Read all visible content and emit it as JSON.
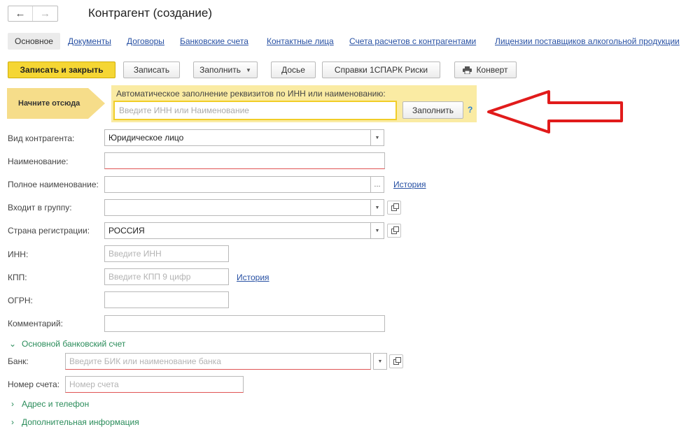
{
  "window": {
    "title": "Контрагент (создание)"
  },
  "nav": {
    "back_icon": "arrow-left-icon",
    "forward_icon": "arrow-right-icon"
  },
  "tabs": [
    {
      "label": "Основное",
      "active": true
    },
    {
      "label": "Документы"
    },
    {
      "label": "Договоры"
    },
    {
      "label": "Банковские счета"
    },
    {
      "label": "Контактные лица"
    },
    {
      "label": "Счета расчетов с контрагентами"
    },
    {
      "label": "Лицензии поставщиков алкогольной продукции"
    }
  ],
  "toolbar": {
    "save_close": "Записать и закрыть",
    "save": "Записать",
    "fill": "Заполнить",
    "dossier": "Досье",
    "spark": "Справки 1СПАРК Риски",
    "envelope": "Конверт"
  },
  "start": {
    "label": "Начните отсюда",
    "caption": "Автоматическое заполнение реквизитов по ИНН или наименованию:",
    "placeholder": "Введите ИНН или Наименование",
    "fill_button": "Заполнить",
    "help": "?"
  },
  "form": {
    "kind_label": "Вид контрагента:",
    "kind_value": "Юридическое лицо",
    "name_label": "Наименование:",
    "name_value": "",
    "fullname_label": "Полное наименование:",
    "fullname_value": "",
    "fullname_dots": "...",
    "history_link": "История",
    "group_label": "Входит в группу:",
    "group_value": "",
    "country_label": "Страна регистрации:",
    "country_value": "РОССИЯ",
    "inn_label": "ИНН:",
    "inn_placeholder": "Введите ИНН",
    "kpp_label": "КПП:",
    "kpp_placeholder": "Введите КПП 9 цифр",
    "kpp_history_link": "История",
    "ogrn_label": "ОГРН:",
    "ogrn_value": "",
    "comment_label": "Комментарий:",
    "comment_value": ""
  },
  "bank_section": {
    "title": "Основной банковский счет",
    "bank_label": "Банк:",
    "bank_placeholder": "Введите БИК или наименование банка",
    "account_label": "Номер счета:",
    "account_placeholder": "Номер счета"
  },
  "sections": {
    "address": "Адрес и телефон",
    "extra": "Дополнительная информация"
  },
  "colors": {
    "primary_button": "#f5d634",
    "link": "#2750a3",
    "group_title": "#2a8c5a",
    "fill_panel": "#faeba3",
    "annotation_arrow": "#e11b1b"
  }
}
